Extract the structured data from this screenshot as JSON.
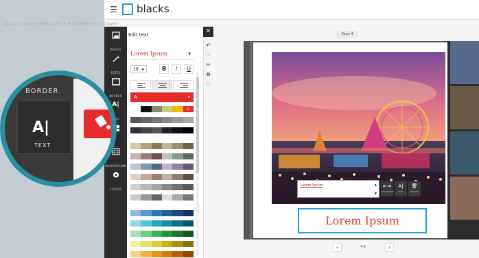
{
  "header": {
    "menu_icon": "hamburger-icon",
    "brand": "blacks"
  },
  "product": {
    "subtitle": "12x12 Square Book with a Printable Hard Cover"
  },
  "sidebar": {
    "items": [
      {
        "label": "PHOTO",
        "icon": "image-icon"
      },
      {
        "label": "FILTER",
        "icon": "wand-icon"
      },
      {
        "label": "BORDER",
        "icon": "border-icon"
      },
      {
        "label": "TEXT",
        "icon": "text-icon"
      },
      {
        "label": "",
        "icon": "layout-icon"
      },
      {
        "label": "BACKGROUND",
        "icon": "background-icon"
      },
      {
        "label": "CLIPART",
        "icon": "clipart-icon"
      }
    ]
  },
  "edit_text": {
    "title": "Edit text",
    "font": "Lorem Ipsum",
    "size": "10",
    "bold": "B",
    "italic": "I",
    "underline": "U",
    "color_label": "A"
  },
  "palette": {
    "top": [
      "#ffffff",
      "#111111",
      "#8a8a6a",
      "#c9c97a",
      "#f0b800",
      "#e52b2b"
    ],
    "rows": [
      [
        "#555555",
        "#666666",
        "#777777",
        "#888888",
        "#999999",
        "#aaaaaa"
      ],
      [
        "#333333",
        "#444444",
        "#555555",
        "#222222",
        "#111111",
        "#000000"
      ],
      [
        "#d9c7a8",
        "#b3a27c",
        "#8a7a56",
        "#c2b59a",
        "#9f8f6a",
        "#6f6142"
      ],
      [
        "#c7b1b1",
        "#9b7a7a",
        "#6e4f4f",
        "#b5c2b5",
        "#879887",
        "#5c6c5c"
      ],
      [
        "#b8c4d6",
        "#8596ad",
        "#58698a",
        "#c0b0c8",
        "#94809f",
        "#6a5676"
      ],
      [
        "#e0d0c0",
        "#c0a8a0",
        "#a08070",
        "#bfb0a0",
        "#8f7f6f",
        "#5f4f3f"
      ],
      [
        "#d0d0d0",
        "#b8b8b8",
        "#a0a0a0",
        "#888888",
        "#707070",
        "#585858"
      ],
      [
        "#cccccc",
        "#999999",
        "#666666",
        "#dddddd",
        "#aaaaaa",
        "#777777"
      ],
      [
        "#8fb8e0",
        "#5c97d1",
        "#2f77bd",
        "#1f5fa0",
        "#174a7f",
        "#0f355e"
      ],
      [
        "#8fd8e6",
        "#56c2d6",
        "#21a8c2",
        "#128ea8",
        "#0b7388",
        "#075868"
      ],
      [
        "#a8e0b0",
        "#70cc80",
        "#3fb053",
        "#2a913e",
        "#1d7330",
        "#125522"
      ],
      [
        "#f0f0a0",
        "#e8e06a",
        "#dccb36",
        "#c9b21a",
        "#a99212",
        "#86720b"
      ],
      [
        "#f6d08a",
        "#f0b44c",
        "#e8961a",
        "#d67b0c",
        "#b35f06",
        "#8f4703"
      ]
    ]
  },
  "toolbar": {
    "close": "✕",
    "undo": "↶",
    "redo": "↷",
    "cut": "✂",
    "copy": "⧉",
    "paste": "⎘"
  },
  "page_badge": "Page 4",
  "caption": {
    "text": "Lorem Ipsum"
  },
  "mini_tools": [
    {
      "glyph": "⇤⇥",
      "label": "TRANSFORM"
    },
    {
      "glyph": "A|",
      "label": "TEXT"
    },
    {
      "glyph": "🗑",
      "label": "DELETE"
    }
  ],
  "text_frame": "Lorem Ipsum",
  "pager": {
    "prev": "‹",
    "label": "4-5",
    "next": "›"
  },
  "magnifier": {
    "border_label": "BORDER",
    "text_label": "TEXT",
    "glyph": "A|"
  }
}
